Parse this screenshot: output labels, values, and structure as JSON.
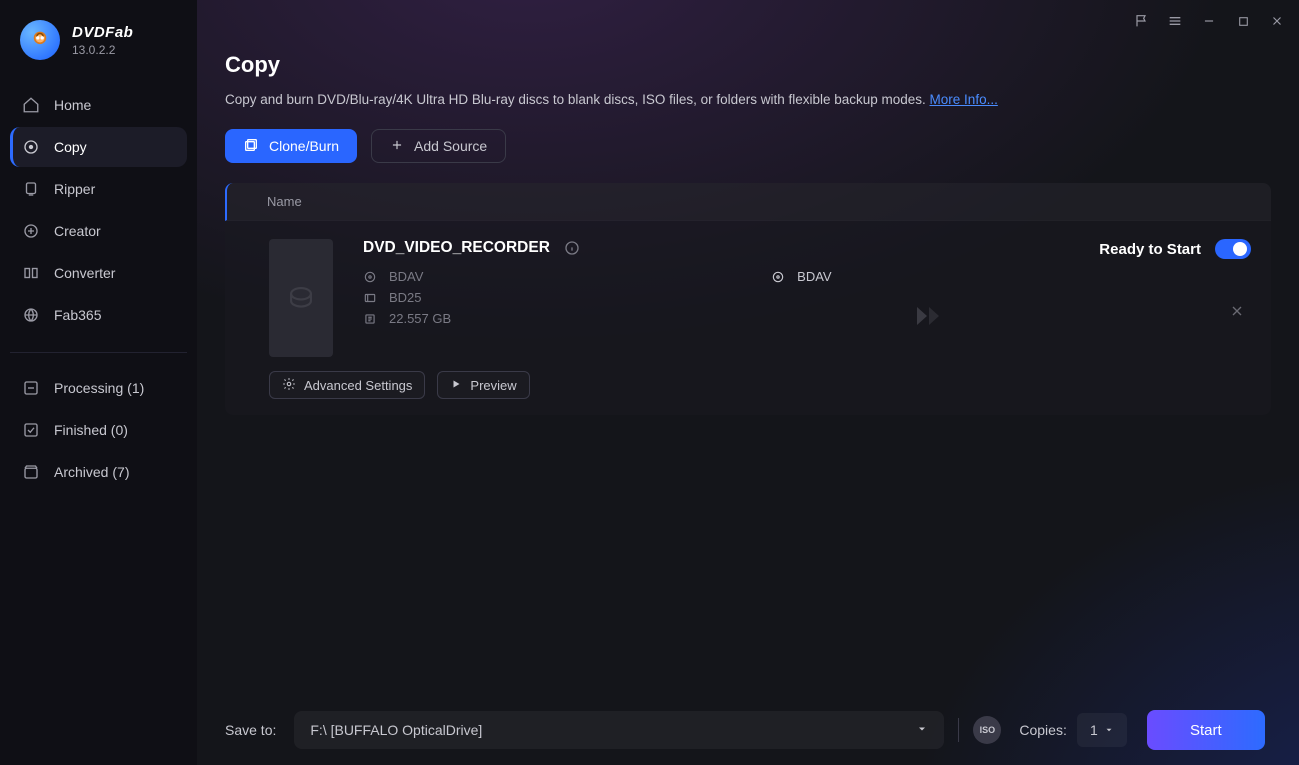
{
  "brand": {
    "name": "DVDFab",
    "version": "13.0.2.2"
  },
  "sidebar": {
    "items": [
      {
        "label": "Home"
      },
      {
        "label": "Copy"
      },
      {
        "label": "Ripper"
      },
      {
        "label": "Creator"
      },
      {
        "label": "Converter"
      },
      {
        "label": "Fab365"
      }
    ],
    "status": {
      "processing": {
        "label": "Processing",
        "count": 1
      },
      "finished": {
        "label": "Finished",
        "count": 0
      },
      "archived": {
        "label": "Archived",
        "count": 7
      }
    }
  },
  "header": {
    "title": "Copy",
    "description": "Copy and burn DVD/Blu-ray/4K Ultra HD Blu-ray discs to blank discs, ISO files, or folders with flexible backup modes.",
    "more_info": "More Info..."
  },
  "actions": {
    "clone_burn": "Clone/Burn",
    "add_source": "Add Source"
  },
  "table": {
    "header_name": "Name",
    "row": {
      "title": "DVD_VIDEO_RECORDER",
      "status": "Ready to Start",
      "source_format": "BDAV",
      "media_type": "BD25",
      "size": "22.557 GB",
      "target_format": "BDAV",
      "adv_settings": "Advanced Settings",
      "preview": "Preview"
    }
  },
  "footer": {
    "save_to_label": "Save to:",
    "save_to_value": "F:\\ [BUFFALO OpticalDrive]",
    "iso_label": "ISO",
    "copies_label": "Copies:",
    "copies_value": "1",
    "start": "Start"
  }
}
